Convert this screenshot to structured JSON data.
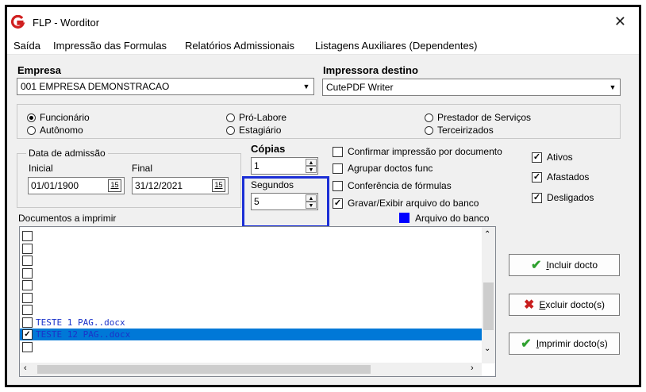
{
  "window": {
    "title": "FLP - Worditor",
    "close_label": "✕"
  },
  "menu": [
    "Saída",
    "Impressão das Formulas",
    "Relatórios Admissionais",
    "Listagens Auxiliares (Dependentes)"
  ],
  "empresa": {
    "label": "Empresa",
    "value": "001 EMPRESA DEMONSTRACAO"
  },
  "impressora": {
    "label": "Impressora destino",
    "value": "CutePDF Writer"
  },
  "tipos": [
    {
      "label": "Funcionário",
      "checked": true
    },
    {
      "label": "Autônomo",
      "checked": false
    },
    {
      "label": "Pró-Labore",
      "checked": false
    },
    {
      "label": "Estagiário",
      "checked": false
    },
    {
      "label": "Prestador de Serviços",
      "checked": false
    },
    {
      "label": "Terceirizados",
      "checked": false
    }
  ],
  "admissao": {
    "legend": "Data de admissão",
    "inicial_label": "Inicial",
    "inicial_value": "01/01/1900",
    "final_label": "Final",
    "final_value": "31/12/2021",
    "cal_glyph": "15"
  },
  "copias": {
    "label": "Cópias",
    "value": "1"
  },
  "segundos": {
    "label": "Segundos",
    "value": "5"
  },
  "opcoes": [
    {
      "label": "Confirmar impressão por documento",
      "checked": false
    },
    {
      "label": "Agrupar doctos func",
      "checked": false
    },
    {
      "label": "Conferência de fórmulas",
      "checked": false
    },
    {
      "label": "Gravar/Exibir arquivo do banco",
      "checked": true
    }
  ],
  "status": [
    {
      "label": "Ativos",
      "checked": true
    },
    {
      "label": "Afastados",
      "checked": true
    },
    {
      "label": "Desligados",
      "checked": true
    }
  ],
  "arquivo_banco": {
    "label": "Arquivo do banco",
    "color": "#0000ff"
  },
  "documentos": {
    "label": "Documentos a imprimir",
    "rows": [
      {
        "text": "",
        "checked": false
      },
      {
        "text": "",
        "checked": false
      },
      {
        "text": "",
        "checked": false
      },
      {
        "text": "",
        "checked": false
      },
      {
        "text": "",
        "checked": false
      },
      {
        "text": "",
        "checked": false
      },
      {
        "text": "",
        "checked": false
      },
      {
        "text": "TESTE 1 PAG..docx",
        "checked": false
      },
      {
        "text": "TESTE 12 PAG..docx",
        "checked": true
      },
      {
        "text": "",
        "checked": false
      }
    ]
  },
  "buttons": {
    "incluir": "Incluir docto",
    "excluir": "Excluir docto(s)",
    "imprimir": "Imprimir docto(s)"
  },
  "colors": {
    "selection": "#0078d7",
    "highlight_box": "#1c2fd6",
    "check_green": "#2ea02e",
    "x_red": "#c81e1e",
    "app_icon": "#d02020"
  }
}
